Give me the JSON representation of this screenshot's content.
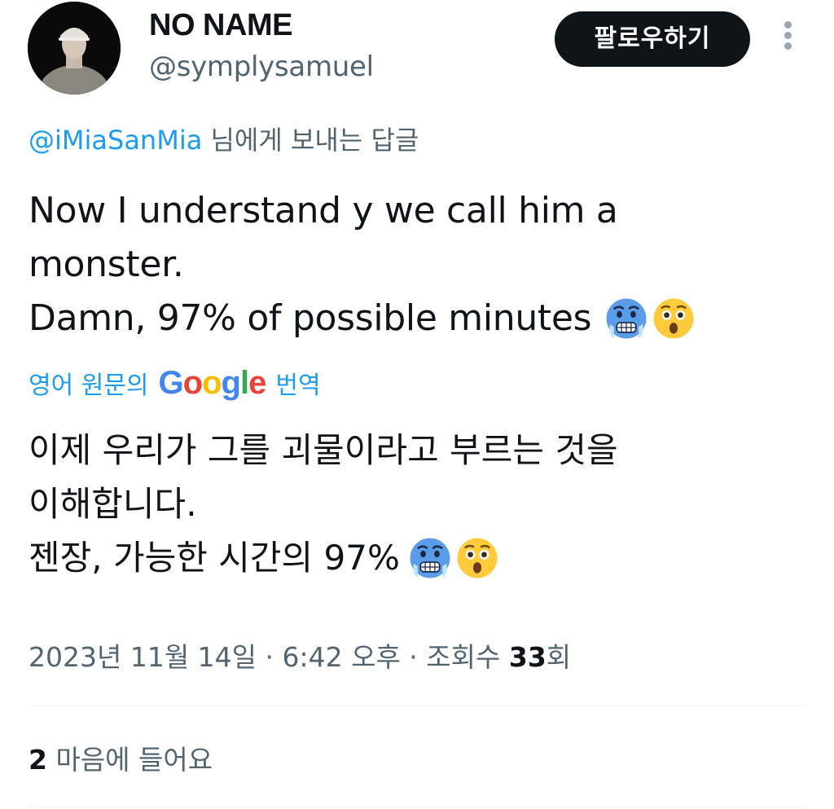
{
  "author": {
    "display_name": "NO NAME",
    "handle": "@symplysamuel"
  },
  "header": {
    "follow_label": "팔로우하기",
    "more_icon": "vertical-ellipsis-icon"
  },
  "reply_context": {
    "handle": "@iMiaSanMia",
    "suffix": " 님에게 보내는 답글"
  },
  "tweet": {
    "lines": [
      "Now I understand y we call him a",
      "monster.",
      "Damn, 97% of possible minutes"
    ],
    "emojis": [
      "cold-face-emoji",
      "astonished-face-emoji"
    ]
  },
  "translation": {
    "prefix": "영어 원문의",
    "google_logo": "Google",
    "suffix": "번역",
    "lines": [
      "이제 우리가 그를 괴물이라고 부르는 것을",
      "이해합니다.",
      "젠장, 가능한 시간의 97%"
    ]
  },
  "meta": {
    "timestamp": "2023년 11월 14일 · 6:42 오후 · 조회수 ",
    "views_count": "33",
    "views_suffix": "회"
  },
  "engagement": {
    "likes_count": "2",
    "likes_label": " 마음에 들어요"
  },
  "colors": {
    "link": "#1d9bf0",
    "secondary_text": "#536471",
    "primary_text": "#0f1419",
    "button_bg": "#0f1419",
    "divider": "#eff3f4"
  }
}
